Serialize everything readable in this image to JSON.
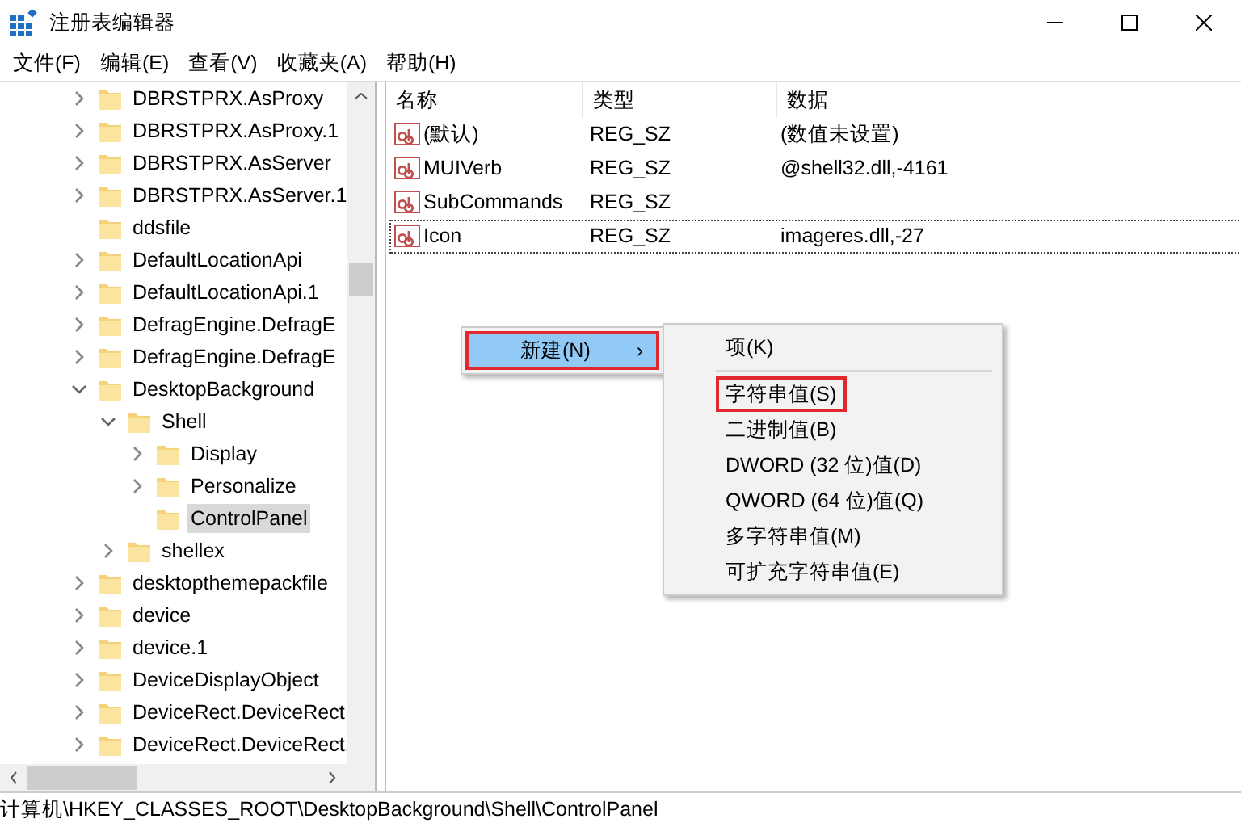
{
  "window": {
    "title": "注册表编辑器"
  },
  "menu_bar": [
    "文件(F)",
    "编辑(E)",
    "查看(V)",
    "收藏夹(A)",
    "帮助(H)"
  ],
  "tree": [
    {
      "label": "DBRSTPRX.AsProxy",
      "kind": "branch",
      "expanded": false,
      "selected": false
    },
    {
      "label": "DBRSTPRX.AsProxy.1",
      "kind": "branch",
      "expanded": false,
      "selected": false
    },
    {
      "label": "DBRSTPRX.AsServer",
      "kind": "branch",
      "expanded": false,
      "selected": false
    },
    {
      "label": "DBRSTPRX.AsServer.1",
      "kind": "branch",
      "expanded": false,
      "selected": false
    },
    {
      "label": "ddsfile",
      "kind": "leaf",
      "selected": false
    },
    {
      "label": "DefaultLocationApi",
      "kind": "branch",
      "expanded": false,
      "selected": false
    },
    {
      "label": "DefaultLocationApi.1",
      "kind": "branch",
      "expanded": false,
      "selected": false
    },
    {
      "label": "DefragEngine.DefragE",
      "kind": "branch",
      "expanded": false,
      "selected": false
    },
    {
      "label": "DefragEngine.DefragE",
      "kind": "branch",
      "expanded": false,
      "selected": false
    },
    {
      "label": "DesktopBackground",
      "kind": "branch",
      "expanded": true,
      "selected": false,
      "children": [
        {
          "label": "Shell",
          "kind": "branch",
          "expanded": true,
          "selected": false,
          "children": [
            {
              "label": "Display",
              "kind": "branch",
              "expanded": false,
              "selected": false
            },
            {
              "label": "Personalize",
              "kind": "branch",
              "expanded": false,
              "selected": false
            },
            {
              "label": "ControlPanel",
              "kind": "leaf",
              "selected": true
            }
          ]
        },
        {
          "label": "shellex",
          "kind": "branch",
          "expanded": false,
          "selected": false
        }
      ]
    },
    {
      "label": "desktopthemepackfile",
      "kind": "branch",
      "expanded": false,
      "selected": false
    },
    {
      "label": "device",
      "kind": "branch",
      "expanded": false,
      "selected": false
    },
    {
      "label": "device.1",
      "kind": "branch",
      "expanded": false,
      "selected": false
    },
    {
      "label": "DeviceDisplayObject",
      "kind": "branch",
      "expanded": false,
      "selected": false
    },
    {
      "label": "DeviceRect.DeviceRect",
      "kind": "branch",
      "expanded": false,
      "selected": false
    },
    {
      "label": "DeviceRect.DeviceRect.",
      "kind": "branch",
      "expanded": false,
      "selected": false
    }
  ],
  "values": {
    "columns": [
      "名称",
      "类型",
      "数据"
    ],
    "rows": [
      {
        "name": "(默认)",
        "type": "REG_SZ",
        "data": "(数值未设置)",
        "selected": false
      },
      {
        "name": "MUIVerb",
        "type": "REG_SZ",
        "data": "@shell32.dll,-4161",
        "selected": false
      },
      {
        "name": "SubCommands",
        "type": "REG_SZ",
        "selected": false
      },
      {
        "name": "Icon",
        "type": "REG_SZ",
        "data": "imageres.dll,-27",
        "selected": true
      }
    ]
  },
  "context_menu": {
    "items": [
      {
        "label": "新建(N)",
        "arrow": "›",
        "selected": true,
        "highlighted": true
      }
    ]
  },
  "submenu": {
    "items": [
      {
        "label": "项(K)",
        "highlighted": false
      },
      {
        "label": "字符串值(S)",
        "highlighted": true
      },
      {
        "label": "二进制值(B)",
        "highlighted": false
      },
      {
        "label": "DWORD (32 位)值(D)",
        "highlighted": false
      },
      {
        "label": "QWORD (64 位)值(Q)",
        "highlighted": false
      },
      {
        "label": "多字符串值(M)",
        "highlighted": false
      },
      {
        "label": "可扩充字符串值(E)",
        "highlighted": false
      }
    ]
  },
  "status_bar": "计算机\\HKEY_CLASSES_ROOT\\DesktopBackground\\Shell\\ControlPanel"
}
